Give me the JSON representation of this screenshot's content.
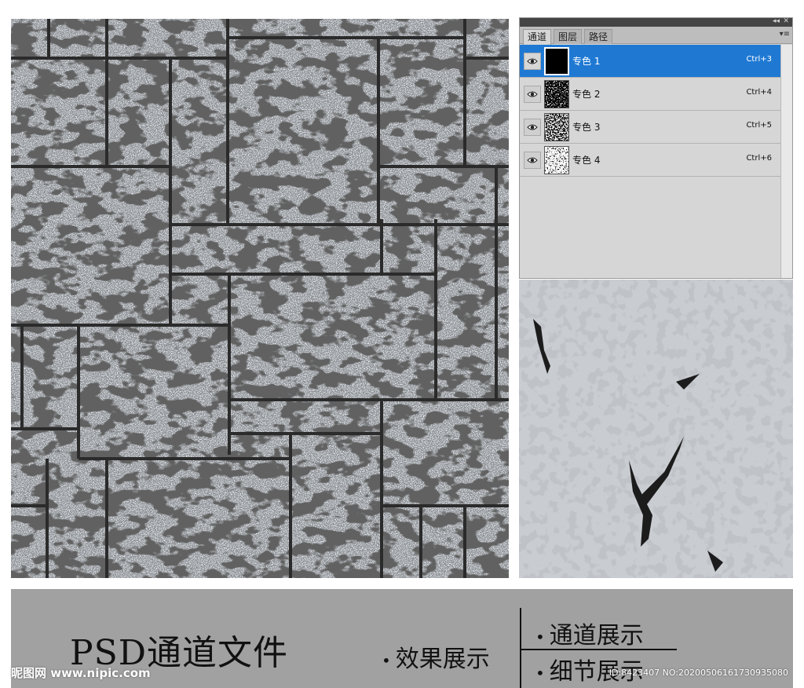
{
  "panel": {
    "collapse_glyph": "◂◂",
    "close_glyph": "✕",
    "menu_glyph": "▾≡",
    "tabs": [
      {
        "label": "通道",
        "active": true
      },
      {
        "label": "图层",
        "active": false
      },
      {
        "label": "路径",
        "active": false
      }
    ],
    "channels": [
      {
        "name": "专色 1",
        "shortcut": "Ctrl+3",
        "selected": true,
        "thumb": "solid-black"
      },
      {
        "name": "专色 2",
        "shortcut": "Ctrl+4",
        "selected": false,
        "thumb": "speckle-dark"
      },
      {
        "name": "专色 3",
        "shortcut": "Ctrl+5",
        "selected": false,
        "thumb": "speckle-mid"
      },
      {
        "name": "专色 4",
        "shortcut": "Ctrl+6",
        "selected": false,
        "thumb": "speckle-light"
      }
    ],
    "eye_icon": "visibility-eye-icon"
  },
  "banner": {
    "title": "PSD通道文件",
    "item_effect": "效果展示",
    "item_channel": "通道展示",
    "item_detail": "细节展示",
    "bullet": "•",
    "watermark_left": "昵图网 www.nipic.com",
    "watermark_right": "ID:8423407 NO:20200506161730935080"
  },
  "colors": {
    "selection_blue": "#1f79d3",
    "stone_gray": "#8f9397",
    "stone_light": "#c9cdd2",
    "grout_dark": "#2b2b2b",
    "banner_gray": "#a1a1a1"
  }
}
